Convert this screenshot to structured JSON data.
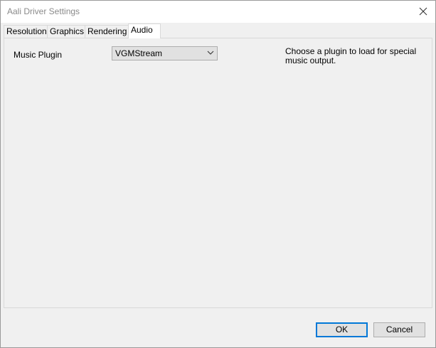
{
  "window": {
    "title": "Aali Driver Settings"
  },
  "tabs": [
    {
      "label": "Resolution",
      "active": false
    },
    {
      "label": "Graphics",
      "active": false
    },
    {
      "label": "Rendering",
      "active": false
    },
    {
      "label": "Audio",
      "active": true
    }
  ],
  "audio": {
    "music_plugin_label": "Music Plugin",
    "music_plugin_value": "VGMStream",
    "help_text": "Choose a plugin to load for special music output."
  },
  "buttons": {
    "ok_label": "OK",
    "cancel_label": "Cancel"
  },
  "icons": {
    "close": "close-icon",
    "dropdown": "chevron-down-icon"
  },
  "colors": {
    "focus_border": "#0078d7",
    "dialog_background": "#f0f0f0",
    "title_text": "#8a8a8a"
  }
}
